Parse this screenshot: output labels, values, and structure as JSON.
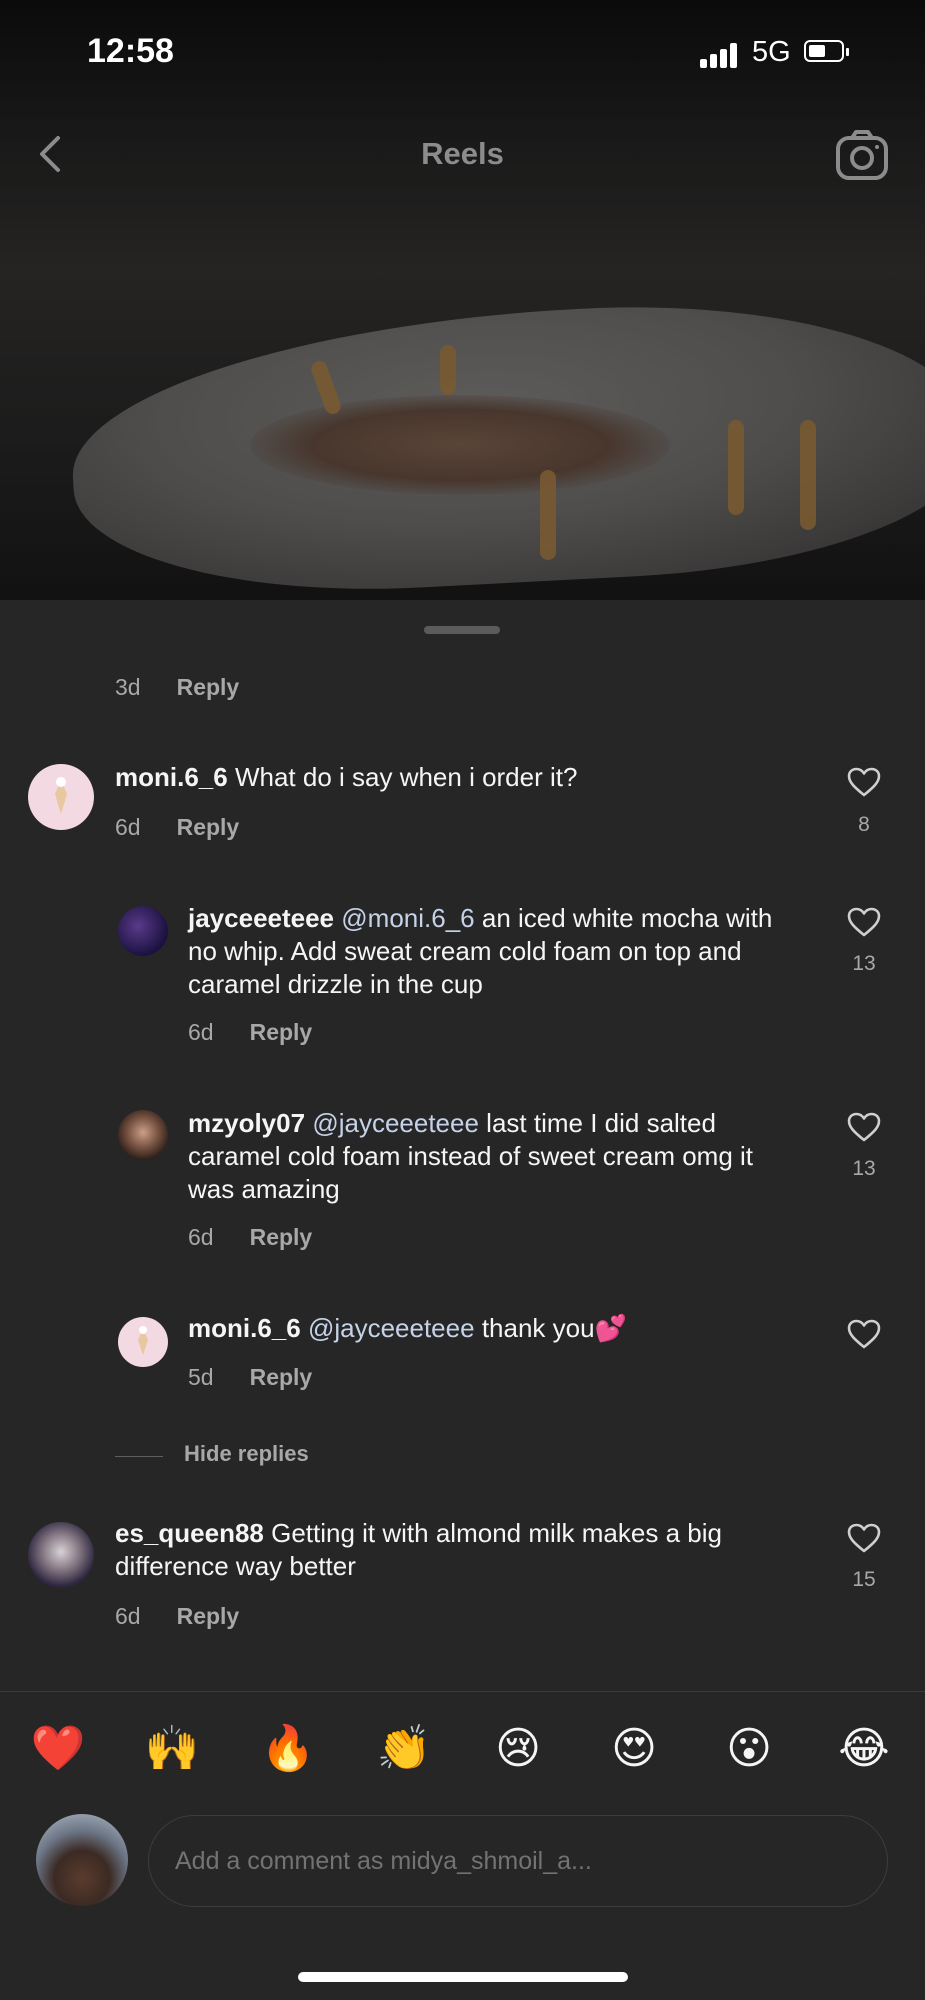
{
  "status_bar": {
    "time": "12:58",
    "network": "5G"
  },
  "header": {
    "title": "Reels"
  },
  "partial_comment": {
    "time": "3d",
    "reply_label": "Reply"
  },
  "comments": [
    {
      "username": "moni.6_6",
      "text": "What do i say when i order it?",
      "time": "6d",
      "reply_label": "Reply",
      "likes": "8"
    },
    {
      "username": "jayceeeteee",
      "mention": "@moni.6_6",
      "text": "an iced white mocha with no whip. Add sweat cream cold foam on top and caramel drizzle in the cup",
      "time": "6d",
      "reply_label": "Reply",
      "likes": "13"
    },
    {
      "username": "mzyoly07",
      "mention": "@jayceeeteee",
      "text": "last time I did salted caramel cold foam instead of sweet cream omg it was amazing",
      "time": "6d",
      "reply_label": "Reply",
      "likes": "13"
    },
    {
      "username": "moni.6_6",
      "mention": "@jayceeeteee",
      "text": "thank you💕",
      "time": "5d",
      "reply_label": "Reply"
    },
    {
      "username": "es_queen88",
      "text": "Getting it with almond milk makes a big difference way better",
      "time": "6d",
      "reply_label": "Reply",
      "likes": "15"
    }
  ],
  "hide_replies_label": "Hide replies",
  "reactions": [
    "❤️",
    "🙌",
    "🔥",
    "👏",
    "😢",
    "😍",
    "😮",
    "😂"
  ],
  "comment_input": {
    "placeholder": "Add a comment as midya_shmoil_a..."
  },
  "colors": {
    "background": "#262626",
    "secondary_text": "#a8a8a8",
    "mention": "#c5d2e8"
  }
}
